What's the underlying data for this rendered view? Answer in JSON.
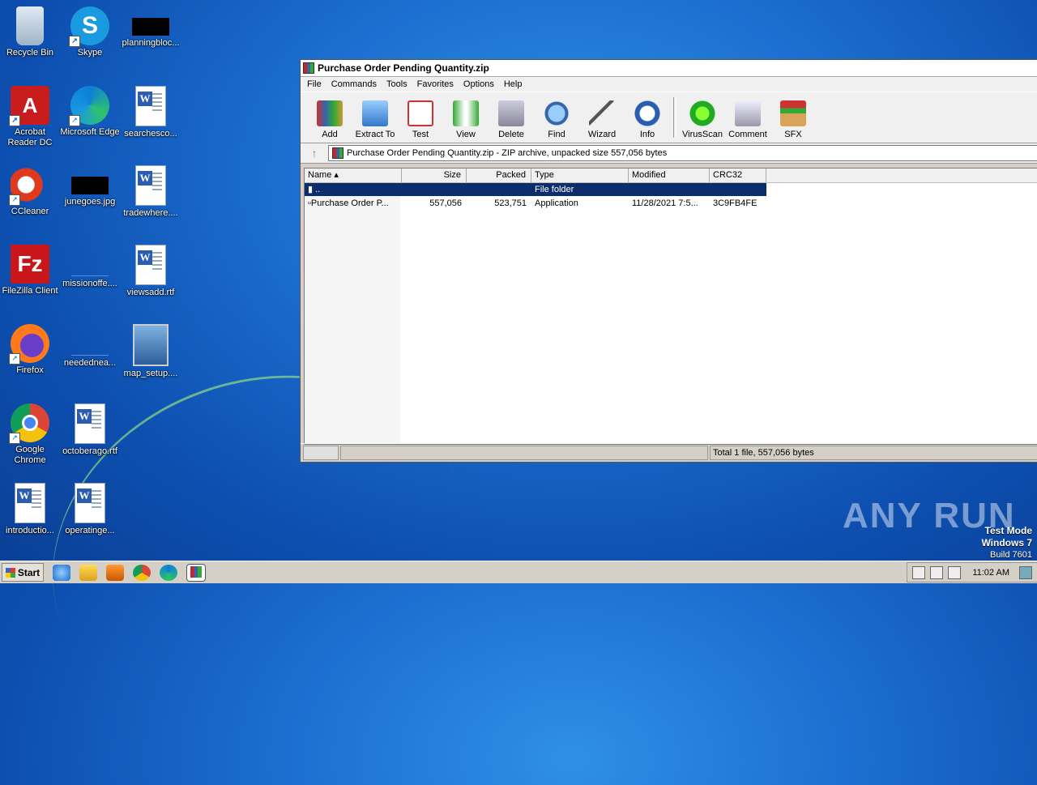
{
  "desktop": {
    "icons": [
      {
        "label": "Recycle Bin",
        "icon": "recycle-bin-icon"
      },
      {
        "label": "Skype",
        "icon": "skype-icon"
      },
      {
        "label": "planningbloc...",
        "icon": "image-file-icon"
      },
      {
        "label": "Acrobat\nReader DC",
        "icon": "acrobat-icon"
      },
      {
        "label": "Microsoft Edge",
        "icon": "edge-icon"
      },
      {
        "label": "searchesco...",
        "icon": "word-doc-icon"
      },
      {
        "label": "CCleaner",
        "icon": "ccleaner-icon"
      },
      {
        "label": "junegoes.jpg",
        "icon": "image-file-icon"
      },
      {
        "label": "tradewhere....",
        "icon": "word-doc-icon"
      },
      {
        "label": "FileZilla Client",
        "icon": "filezilla-icon"
      },
      {
        "label": "missionoffe....",
        "icon": "blank-file-icon"
      },
      {
        "label": "viewsadd.rtf",
        "icon": "word-doc-icon"
      },
      {
        "label": "Firefox",
        "icon": "firefox-icon"
      },
      {
        "label": "neededneа...",
        "icon": "blank-file-icon"
      },
      {
        "label": "map_setup....",
        "icon": "setup-icon"
      },
      {
        "label": "Google\nChrome",
        "icon": "chrome-icon"
      },
      {
        "label": "octoberago.rtf",
        "icon": "word-doc-icon"
      },
      {
        "label": "introductio...",
        "icon": "word-doc-icon"
      },
      {
        "label": "operatinge...",
        "icon": "word-doc-icon"
      }
    ]
  },
  "window": {
    "title": "Purchase Order Pending Quantity.zip",
    "menu": [
      "File",
      "Commands",
      "Tools",
      "Favorites",
      "Options",
      "Help"
    ],
    "toolbar": [
      "Add",
      "Extract To",
      "Test",
      "View",
      "Delete",
      "Find",
      "Wizard",
      "Info",
      "VirusScan",
      "Comment",
      "SFX"
    ],
    "address": "Purchase Order Pending Quantity.zip - ZIP archive, unpacked size 557,056 bytes",
    "columns": [
      "Name",
      "Size",
      "Packed",
      "Type",
      "Modified",
      "CRC32"
    ],
    "rows": [
      {
        "name": "..",
        "size": "",
        "packed": "",
        "type": "File folder",
        "modified": "",
        "crc": ""
      },
      {
        "name": "Purchase Order P...",
        "size": "557,056",
        "packed": "523,751",
        "type": "Application",
        "modified": "11/28/2021 7:5...",
        "crc": "3C9FB4FE"
      }
    ],
    "status": "Total 1 file, 557,056 bytes"
  },
  "watermark": "ANY RUN",
  "testmode": {
    "line1": "Test Mode",
    "line2": "Windows 7",
    "line3": "Build 7601"
  },
  "taskbar": {
    "start": "Start",
    "clock": "11:02 AM"
  },
  "colors": {
    "selection": "#0b2d6b",
    "desktop": "#1c6fd0",
    "chrome": "#d4d0c8"
  }
}
